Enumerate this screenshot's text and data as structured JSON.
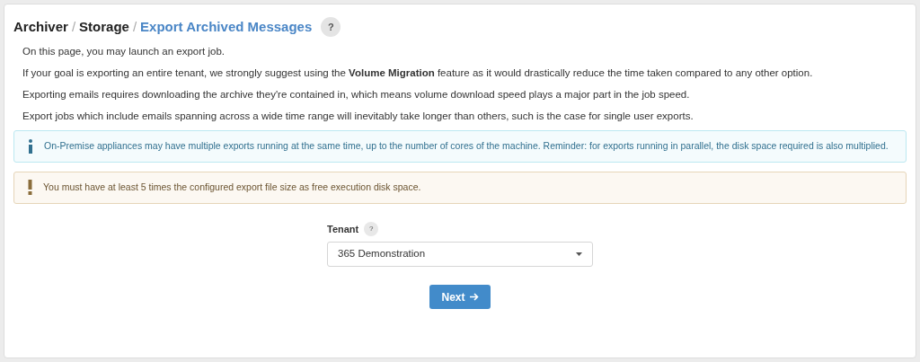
{
  "breadcrumb": [
    {
      "label": "Archiver",
      "current": false
    },
    {
      "label": "Storage",
      "current": false
    },
    {
      "label": "Export Archived Messages",
      "current": true
    }
  ],
  "breadcrumb_separator": "/",
  "help_button": "?",
  "paragraphs": [
    "On this page, you may launch an export job.",
    "If your goal is exporting an entire tenant, we strongly suggest using the **Volume Migration** feature as it would drastically reduce the time taken compared to any other option.",
    "Exporting emails requires downloading the archive they're contained in, which means volume download speed plays a major part in the job speed.",
    "Export jobs which include emails spanning across a wide time range will inevitably take longer than others, such is the case for single user exports."
  ],
  "alerts": [
    {
      "kind": "info",
      "text": "On-Premise appliances may have multiple exports running at the same time, up to the number of cores of the machine. Reminder: for exports running in parallel, the disk space required is also multiplied."
    },
    {
      "kind": "warning",
      "text": "You must have at least 5 times the configured export file size as free execution disk space."
    }
  ],
  "tenant_field": {
    "label": "Tenant",
    "help": "?",
    "value": "365 Demonstration"
  },
  "next_button": "Next"
}
